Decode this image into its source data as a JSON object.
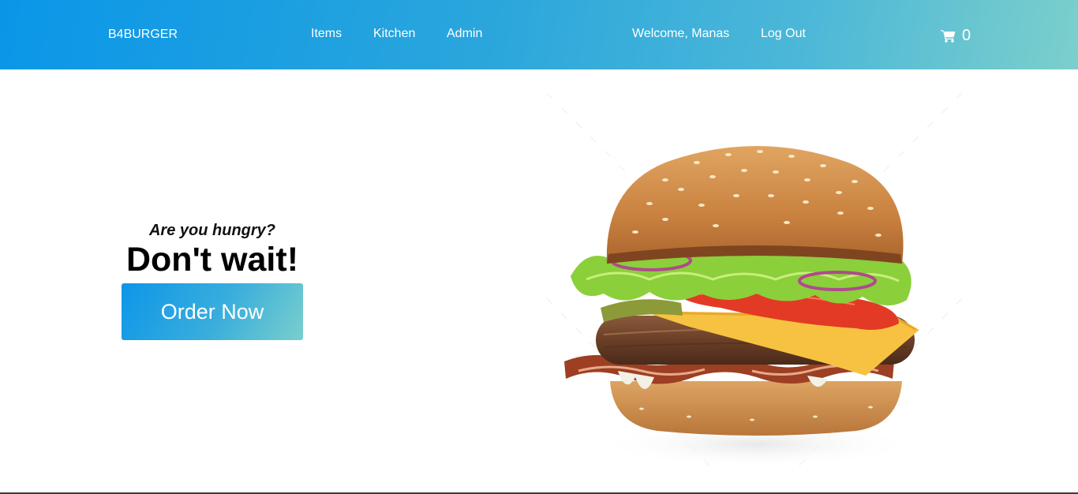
{
  "nav": {
    "brand": "B4BURGER",
    "links": [
      {
        "label": "Items"
      },
      {
        "label": "Kitchen"
      },
      {
        "label": "Admin"
      }
    ],
    "welcome": "Welcome, Manas",
    "logout": "Log Out",
    "cart": {
      "icon": "shopping-cart-icon",
      "count": "0"
    }
  },
  "hero": {
    "tagline": "Are you hungry?",
    "headline": "Don't wait!",
    "cta_label": "Order Now",
    "image": "burger-photo"
  },
  "colors": {
    "nav_gradient_start": "#0a96e8",
    "nav_gradient_end": "#7ccfcb",
    "button_gradient_start": "#0d96e8",
    "button_gradient_end": "#79cfcc"
  }
}
